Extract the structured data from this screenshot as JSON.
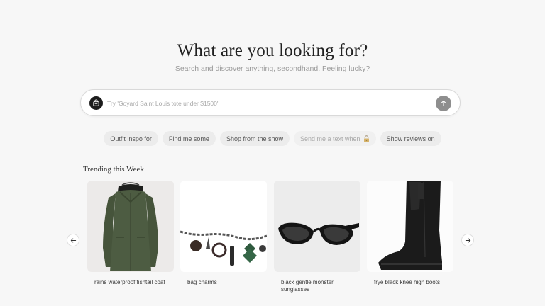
{
  "hero": {
    "title": "What are you looking for?",
    "subtitle": "Search and discover anything, secondhand. Feeling lucky?"
  },
  "search": {
    "placeholder": "Try 'Goyard Saint Louis tote under $1500'",
    "value": "",
    "logo_icon": "bag-icon",
    "submit_icon": "arrow-up-icon"
  },
  "chips": [
    {
      "label": "Outfit inspo for",
      "muted": false
    },
    {
      "label": "Find me some",
      "muted": false
    },
    {
      "label": "Shop from the show",
      "muted": false
    },
    {
      "label": "Send me a text when",
      "muted": true,
      "icon": "lock-icon"
    },
    {
      "label": "Show reviews on",
      "muted": false
    }
  ],
  "trending": {
    "title": "Trending this Week",
    "prev_icon": "arrow-left-icon",
    "next_icon": "arrow-right-icon",
    "items": [
      {
        "caption": "rains waterproof fishtail coat",
        "image": "green-raincoat"
      },
      {
        "caption": "bag charms",
        "image": "chain-bag-charms"
      },
      {
        "caption": "black gentle monster sunglasses",
        "image": "black-sunglasses"
      },
      {
        "caption": "frye black knee high boots",
        "image": "black-knee-boot"
      }
    ]
  },
  "colors": {
    "background": "#f7f7f7",
    "submit_button": "#8e8e8e",
    "chip_background": "#ececec"
  }
}
